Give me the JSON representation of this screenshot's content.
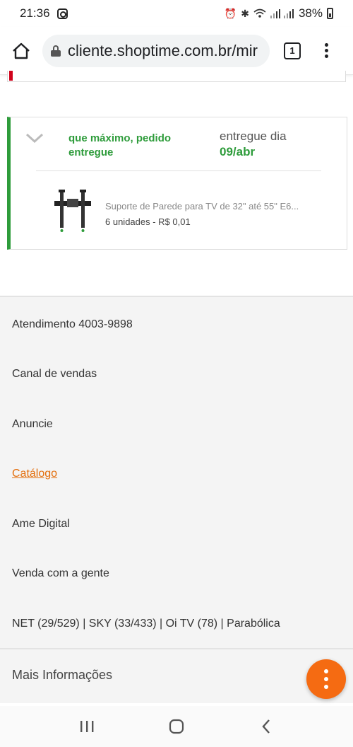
{
  "status_bar": {
    "time": "21:36",
    "battery_percent": "38%",
    "icons": [
      "instagram-icon",
      "alarm-icon",
      "bluetooth-icon",
      "wifi-icon",
      "signal-icon",
      "battery-icon"
    ]
  },
  "browser": {
    "url": "cliente.shoptime.com.br/mir",
    "tab_count": "1"
  },
  "order": {
    "status": "que máximo, pedido entregue",
    "delivery_label": "entregue dia",
    "delivery_date": "09/abr",
    "product_name": "Suporte de Parede para TV de 32\" até 55\" E6...",
    "product_qty": "6 unidades - R$ 0,01",
    "accent_color": "#2e9c3b"
  },
  "footer": {
    "links": [
      "Atendimento 4003-9898",
      "Canal de vendas",
      "Anuncie",
      "Catálogo",
      "Ame Digital",
      "Venda com a gente",
      "NET (29/529) | SKY (33/433) | Oi TV (78) | Parabólica"
    ],
    "more_info": "Mais Informações"
  },
  "fab_color": "#f56b12"
}
